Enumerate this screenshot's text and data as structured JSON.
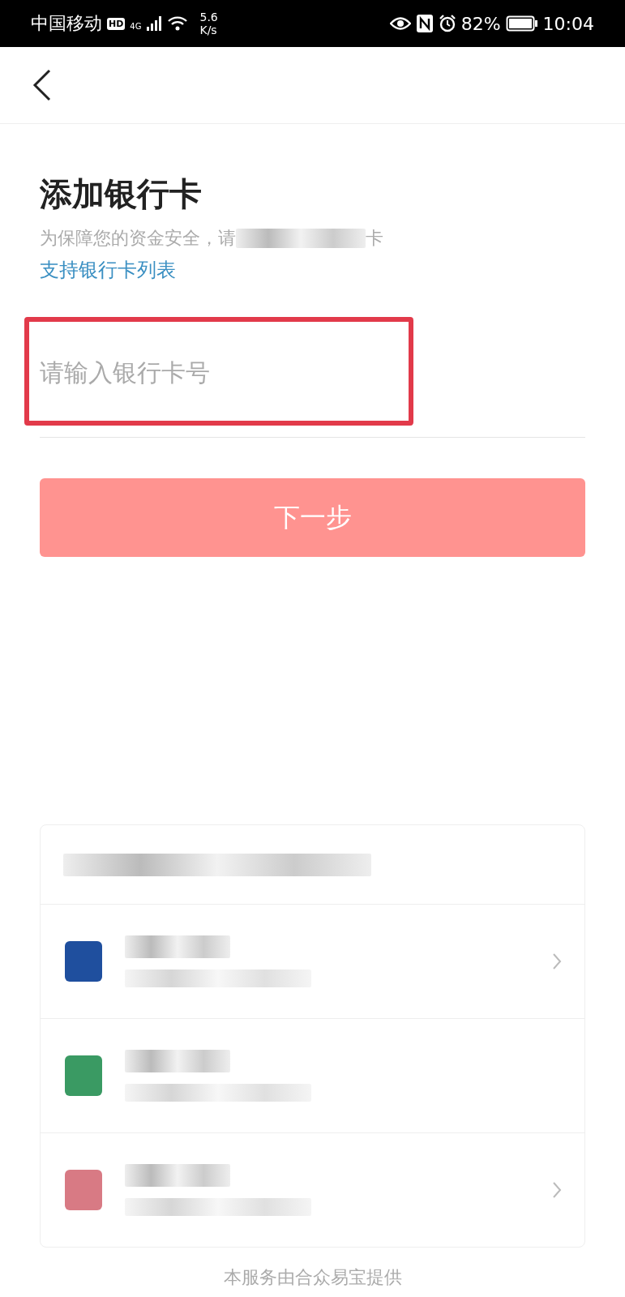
{
  "status_bar": {
    "carrier": "中国移动",
    "hd": "HD",
    "network": "4G",
    "speed_value": "5.6",
    "speed_unit": "K/s",
    "battery": "82%",
    "time": "10:04"
  },
  "title": "添加银行卡",
  "subtitle": {
    "before": "为保障您的资金安全，请",
    "after": "卡"
  },
  "link": "支持银行卡列表",
  "card_field": {
    "placeholder": "请输入银行卡号",
    "highlighted": true
  },
  "next_button": {
    "label": "下一步",
    "disabled": true
  },
  "bank_list": [
    {
      "color": "#1f4f9e",
      "chevron": true
    },
    {
      "color": "#3a9a63",
      "chevron": false
    },
    {
      "color": "#d87a84",
      "chevron": true
    }
  ],
  "footer": "本服务由合众易宝提供"
}
